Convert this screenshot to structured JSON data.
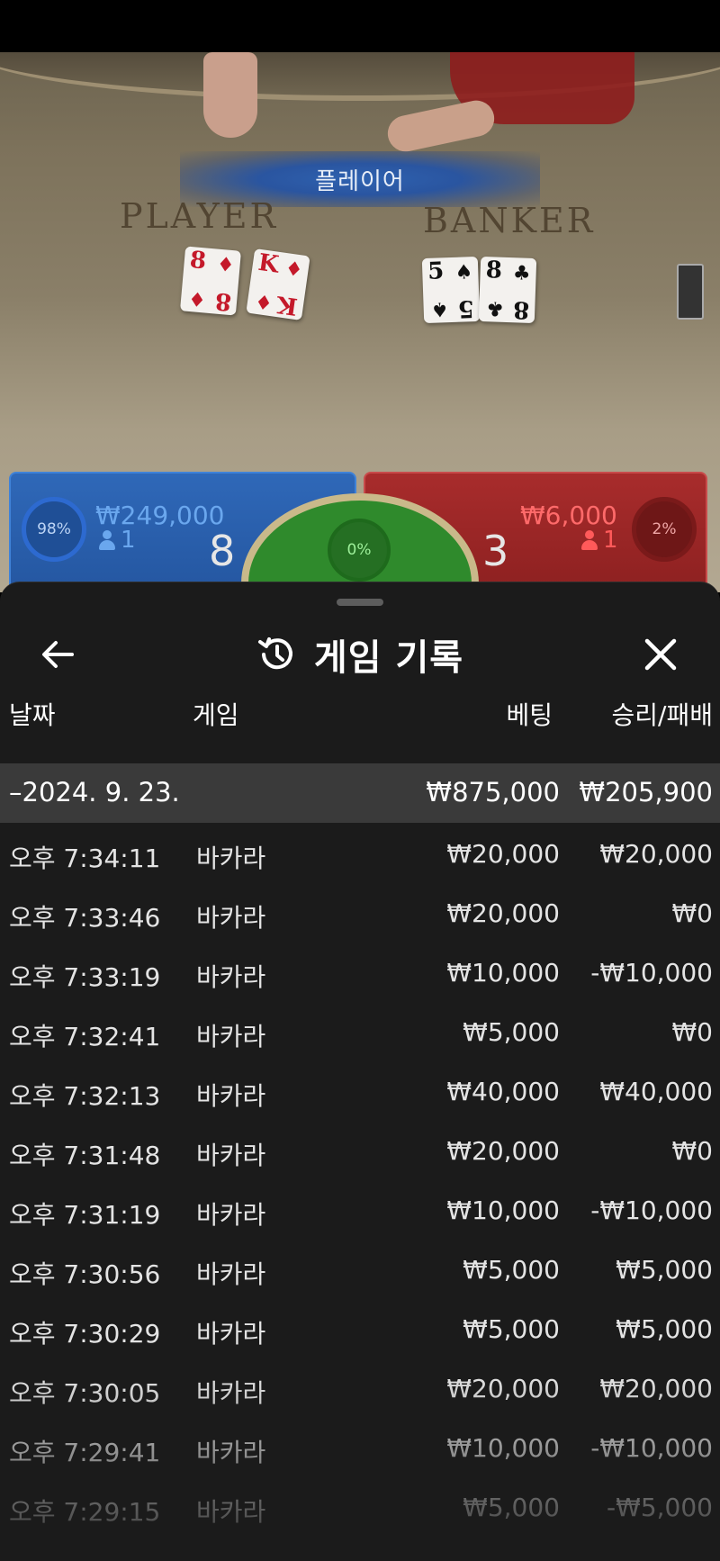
{
  "table": {
    "result_banner": "플레이어",
    "player_label": "PLAYER",
    "banker_label": "BANKER",
    "player_cards": [
      {
        "rank": "8",
        "suit": "♦",
        "color": "#c4192a"
      },
      {
        "rank": "K",
        "suit": "♦",
        "color": "#c4192a"
      }
    ],
    "banker_cards": [
      {
        "rank": "5",
        "suit": "♠",
        "color": "#111111"
      },
      {
        "rank": "8",
        "suit": "♣",
        "color": "#111111"
      }
    ]
  },
  "bets": {
    "player": {
      "percent": "98%",
      "amount": "₩249,000",
      "players": "1",
      "score": "8"
    },
    "tie": {
      "percent": "0%"
    },
    "banker": {
      "percent": "2%",
      "amount": "₩6,000",
      "players": "1",
      "score": "3"
    }
  },
  "history": {
    "title": "게임 기록",
    "columns": {
      "date": "날짜",
      "game": "게임",
      "bet": "베팅",
      "win_loss": "승리/패배"
    },
    "summary": {
      "date": "–2024. 9. 23.",
      "bet": "₩875,000",
      "win_loss": "₩205,900"
    },
    "rows": [
      {
        "time": "오후 7:34:11",
        "game": "바카라",
        "bet": "₩20,000",
        "win_loss": "₩20,000"
      },
      {
        "time": "오후 7:33:46",
        "game": "바카라",
        "bet": "₩20,000",
        "win_loss": "₩0"
      },
      {
        "time": "오후 7:33:19",
        "game": "바카라",
        "bet": "₩10,000",
        "win_loss": "-₩10,000"
      },
      {
        "time": "오후 7:32:41",
        "game": "바카라",
        "bet": "₩5,000",
        "win_loss": "₩0"
      },
      {
        "time": "오후 7:32:13",
        "game": "바카라",
        "bet": "₩40,000",
        "win_loss": "₩40,000"
      },
      {
        "time": "오후 7:31:48",
        "game": "바카라",
        "bet": "₩20,000",
        "win_loss": "₩0"
      },
      {
        "time": "오후 7:31:19",
        "game": "바카라",
        "bet": "₩10,000",
        "win_loss": "-₩10,000"
      },
      {
        "time": "오후 7:30:56",
        "game": "바카라",
        "bet": "₩5,000",
        "win_loss": "₩5,000"
      },
      {
        "time": "오후 7:30:29",
        "game": "바카라",
        "bet": "₩5,000",
        "win_loss": "₩5,000"
      },
      {
        "time": "오후 7:30:05",
        "game": "바카라",
        "bet": "₩20,000",
        "win_loss": "₩20,000"
      },
      {
        "time": "오후 7:29:41",
        "game": "바카라",
        "bet": "₩10,000",
        "win_loss": "-₩10,000"
      },
      {
        "time": "오후 7:29:15",
        "game": "바카라",
        "bet": "₩5,000",
        "win_loss": "-₩5,000"
      }
    ]
  },
  "colors": {
    "player_blue": "#2456a0",
    "banker_red": "#8c2020",
    "tie_green": "#2f8a2c",
    "sheet_bg": "#1b1b1b",
    "summary_bg": "#3a3a3a"
  },
  "icons": {
    "back": "arrow-left-icon",
    "history": "history-clock-icon",
    "close": "close-x-icon"
  }
}
